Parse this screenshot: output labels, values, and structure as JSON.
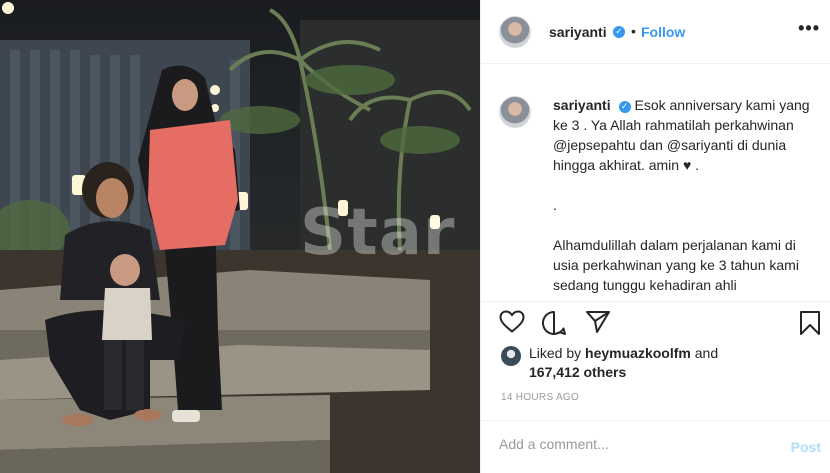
{
  "photo": {
    "watermark": "Star"
  },
  "post": {
    "username": "sariyanti",
    "verified_mark": "✓",
    "separator": "•",
    "follow_label": "Follow",
    "more_label": "•••"
  },
  "caption": {
    "username": "sariyanti",
    "line1": "Esok anniversary kami yang ke 3 . Ya Allah rahmatilah perkahwinan @jepsepahtu dan @sariyanti di dunia hingga akhirat. amin",
    "heart": "♥",
    "line1_end": " .",
    "line2": ".",
    "line3": "Alhamdulillah dalam perjalanan kami di usia perkahwinan yang ke 3 tahun kami sedang tunggu kehadiran ahli"
  },
  "icons": {
    "like": "heart-outline-icon",
    "comment": "comment-bubble-icon",
    "share": "paper-plane-icon",
    "save": "bookmark-icon"
  },
  "likes": {
    "prefix": "Liked by",
    "user": "heymuazkoolfm",
    "and": "and",
    "count": "167,412 others"
  },
  "timestamp": "14 HOURS AGO",
  "comment": {
    "placeholder": "Add a comment...",
    "post_label": "Post"
  },
  "colors": {
    "accent": "#3897f0",
    "post_disabled": "#b2dffc",
    "muted": "#999999",
    "divider": "#efefef"
  }
}
